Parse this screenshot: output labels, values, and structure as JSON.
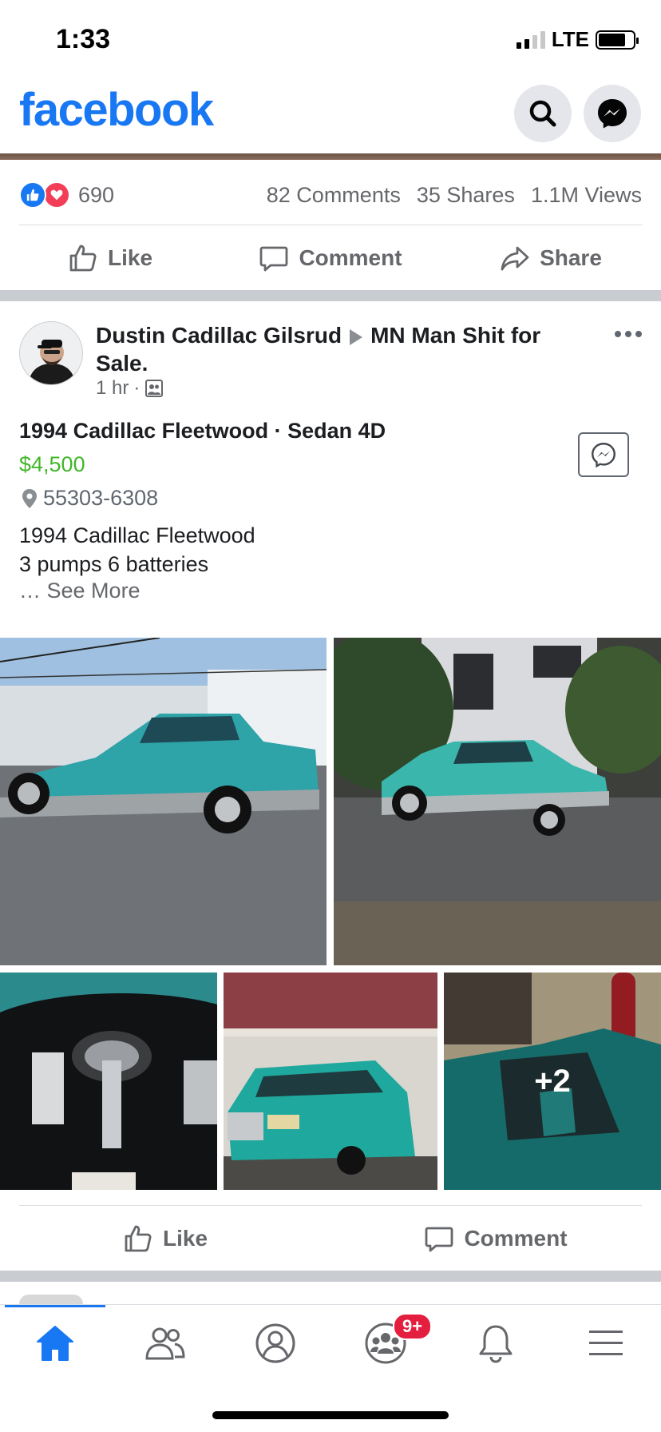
{
  "status_bar": {
    "time": "1:33",
    "network": "LTE"
  },
  "header": {
    "logo": "facebook",
    "search_icon": "search-icon",
    "messenger_icon": "messenger-icon",
    "brand_color": "#1877f2"
  },
  "prev_post": {
    "reaction_count": "690",
    "comments": "82 Comments",
    "shares": "35 Shares",
    "views": "1.1M Views",
    "actions": {
      "like": "Like",
      "comment": "Comment",
      "share": "Share"
    }
  },
  "post": {
    "author": "Dustin Cadillac Gilsrud",
    "group": "MN Man Shit for Sale.",
    "time": "1 hr",
    "listing": {
      "title": "1994 Cadillac Fleetwood · Sedan 4D",
      "price": "$4,500",
      "location": "55303-6308",
      "description_line1": "1994 Cadillac Fleetwood",
      "description_line2": "3 pumps 6 batteries",
      "see_more": "See More",
      "price_color": "#42b72a"
    },
    "more_photos": "+2",
    "actions": {
      "like": "Like",
      "comment": "Comment"
    }
  },
  "tab_bar": {
    "tabs": [
      "home-icon",
      "friends-icon",
      "profile-icon",
      "groups-icon",
      "notifications-icon",
      "menu-icon"
    ],
    "groups_badge": "9+",
    "badge_color": "#e41e3f"
  }
}
